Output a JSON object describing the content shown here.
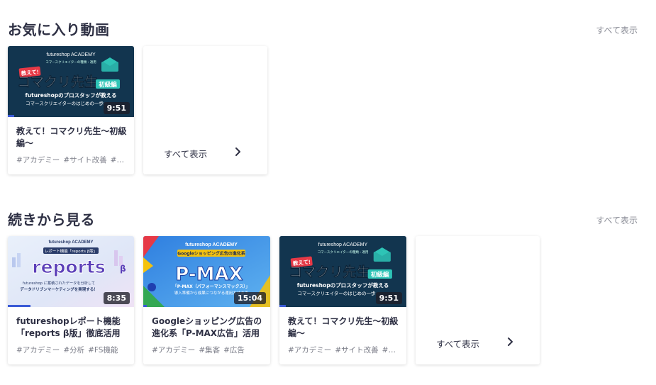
{
  "favorites": {
    "title": "お気に入り動画",
    "more": "すべて表示",
    "cards": [
      {
        "title": "教えて！コマクリ先生〜初級編〜",
        "tags": [
          "#アカデミー",
          "#サイト改善",
          "#コマースクリエイター"
        ],
        "duration": "9:51",
        "progress": 0.05,
        "thumb": {
          "brand": "futureshop ACADEMY",
          "sub": "コマースクリエイターの種類・適用",
          "badge": "教えて!",
          "main": "コマクリ先生",
          "level": "初級編",
          "caption1": "futureshopのプロスタッフが教える",
          "caption2": "コマースクリエイターのはじめの一歩"
        }
      }
    ],
    "more_card_label": "すべて表示"
  },
  "continue": {
    "title": "続きから見る",
    "more": "すべて表示",
    "cards": [
      {
        "title": "futureshopレポート機能「reports β版」徹底活用【…",
        "tags": [
          "#アカデミー",
          "#分析",
          "#FS機能"
        ],
        "duration": "8:35",
        "progress": 0.18,
        "thumb": {
          "brand": "futureshop ACADEMY",
          "badge": "レポート機能「reports β版」",
          "main": "reports",
          "caption1": "futureshop に蓄積されたデータを分析して",
          "caption2": "データドリブンマーケティングを実現する！"
        }
      },
      {
        "title": "Googleショッピング広告の進化系「P-MAX広告」活用講…",
        "tags": [
          "#アカデミー",
          "#集客",
          "#広告"
        ],
        "duration": "15:04",
        "progress": 0.03,
        "thumb": {
          "brand": "futureshop ACADEMY",
          "badge": "Googleショッピング広告の進化系",
          "main": "P-MAX",
          "caption1": "「P-MAX（パフォーマンスマックス）」",
          "caption2": "導入準備から成果につながる運用方法まで"
        }
      },
      {
        "title": "教えて！コマクリ先生〜初級編〜",
        "tags": [
          "#アカデミー",
          "#サイト改善",
          "#コマースクリエイター"
        ],
        "duration": "9:51",
        "progress": 0.05,
        "thumb": {
          "brand": "futureshop ACADEMY",
          "sub": "コマースクリエイターの種類・適用",
          "badge": "教えて!",
          "main": "コマクリ先生",
          "level": "初級編",
          "caption1": "futureshopのプロスタッフが教える",
          "caption2": "コマースクリエイターのはじめの一歩"
        }
      }
    ],
    "more_card_label": "すべて表示"
  },
  "colors": {
    "accent": "#3b5bd6",
    "navy": "#1d3557",
    "teal": "#2ec4b6"
  }
}
